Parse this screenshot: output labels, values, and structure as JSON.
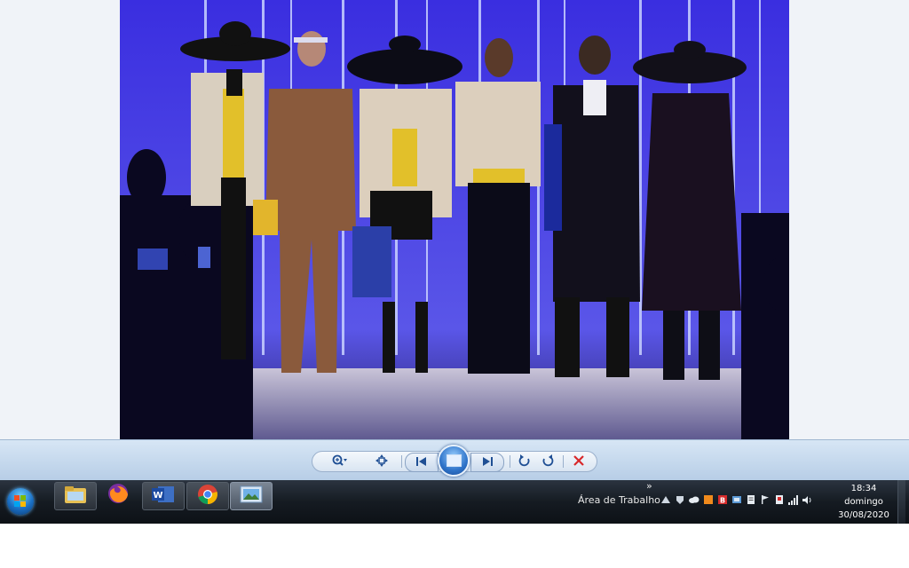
{
  "viewer": {
    "photo_alt": "runway photo",
    "toolbar": {
      "zoom_icon": "zoom-magnifier-icon",
      "fit_icon": "actual-size-icon",
      "prev_icon": "previous-icon",
      "slideshow_icon": "slideshow-icon",
      "next_icon": "next-icon",
      "rotate_left_icon": "rotate-counterclockwise-icon",
      "rotate_right_icon": "rotate-clockwise-icon",
      "delete_icon": "delete-icon"
    }
  },
  "taskbar": {
    "pinned_apps": [
      "file-explorer",
      "firefox",
      "word",
      "chrome",
      "photo-viewer"
    ],
    "desktop_label": "Área de Trabalho",
    "overflow_label": "»",
    "clock": {
      "time": "18:34",
      "day": "domingo",
      "date": "30/08/2020"
    }
  },
  "colors": {
    "taskbar_bg": "#151b22",
    "toolbar_bg": "#c3d7ec",
    "delete_red": "#d8282a",
    "stage_blue": "#2a1fb0"
  }
}
